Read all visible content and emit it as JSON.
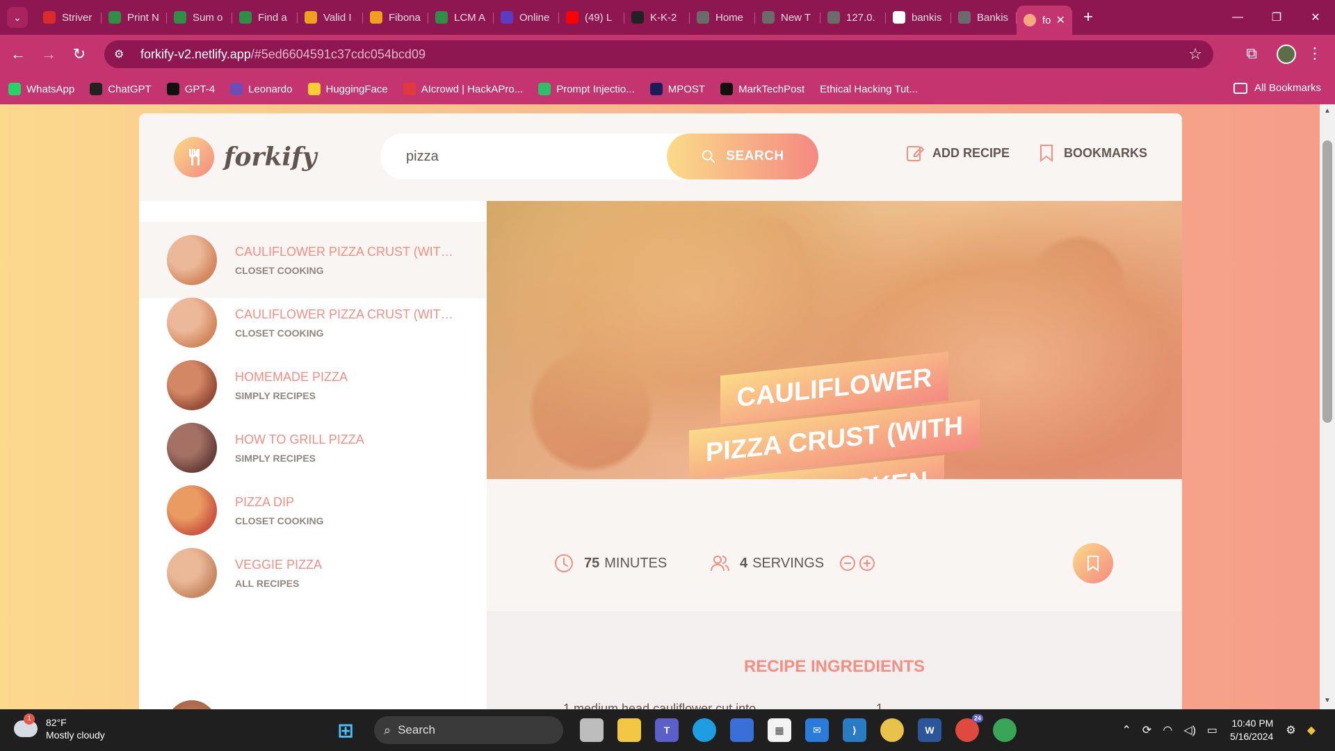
{
  "browser": {
    "tabs": [
      {
        "label": "Striver",
        "color": "#d92b2b",
        "glyph": "TUF"
      },
      {
        "label": "Print N",
        "color": "#2f8d46",
        "glyph": "gg"
      },
      {
        "label": "Sum o",
        "color": "#2f8d46",
        "glyph": "gg"
      },
      {
        "label": "Find a",
        "color": "#2f8d46",
        "glyph": "gg"
      },
      {
        "label": "Valid I",
        "color": "#f0a020",
        "glyph": "L"
      },
      {
        "label": "Fibona",
        "color": "#f0a020",
        "glyph": "L"
      },
      {
        "label": "LCM A",
        "color": "#2f8d46",
        "glyph": "gg"
      },
      {
        "label": "Online",
        "color": "#5b3cc4",
        "glyph": "?"
      },
      {
        "label": "(49) L",
        "color": "#ff0000",
        "glyph": "▶"
      },
      {
        "label": "K-K-2",
        "color": "#222222",
        "glyph": "●"
      },
      {
        "label": "Home",
        "color": "#6b6b6b",
        "glyph": "◎"
      },
      {
        "label": "New T",
        "color": "#6b6b6b",
        "glyph": "◉"
      },
      {
        "label": "127.0.",
        "color": "#6b6b6b",
        "glyph": "◎"
      },
      {
        "label": "bankis",
        "color": "#ffffff",
        "glyph": "G"
      },
      {
        "label": "Bankis",
        "color": "#6b6b6b",
        "glyph": "✲"
      }
    ],
    "active_tab": {
      "label": "fo",
      "color": "#f5a97f"
    },
    "url_host": "forkify-v2.netlify.app",
    "url_path": "/#5ed6604591c37cdc054bcd09",
    "bookmarks": [
      {
        "label": "WhatsApp",
        "color": "#25d366",
        "glyph": "✆"
      },
      {
        "label": "ChatGPT",
        "color": "#222222",
        "glyph": "✺"
      },
      {
        "label": "GPT-4",
        "color": "#111111",
        "glyph": "⚡"
      },
      {
        "label": "Leonardo",
        "color": "#6a4fb6",
        "glyph": "◉"
      },
      {
        "label": "HuggingFace",
        "color": "#ffcc33",
        "glyph": "☺"
      },
      {
        "label": "AIcrowd | HackAPro...",
        "color": "#e03a3a",
        "glyph": "▲"
      },
      {
        "label": "Prompt Injectio...",
        "color": "#2fbf6a",
        "glyph": "●"
      },
      {
        "label": "MPOST",
        "color": "#1c1c5a",
        "glyph": "▪"
      },
      {
        "label": "MarkTechPost",
        "color": "#111111",
        "glyph": "M"
      },
      {
        "label": "Ethical Hacking Tut...",
        "color": "#c4346f",
        "glyph": ""
      }
    ],
    "all_bookmarks": "All Bookmarks"
  },
  "app": {
    "logo_text": "forkify",
    "search_value": "pizza",
    "search_button": "Search",
    "nav": {
      "add_recipe": "Add recipe",
      "bookmarks": "Bookmarks"
    },
    "results": [
      {
        "title": "Cauliflower Pizza Crust (with BBQ Chicken Pizza)",
        "publisher": "Closet Cooking",
        "active": true,
        "thumb": [
          "#e9c9a0",
          "#c98a55"
        ]
      },
      {
        "title": "Cauliflower Pizza Crust (with BBQ Chicken Pizza)",
        "publisher": "Closet Cooking",
        "active": false,
        "thumb": [
          "#e9c9a0",
          "#c98a55"
        ]
      },
      {
        "title": "Homemade Pizza",
        "publisher": "Simply Recipes",
        "active": false,
        "thumb": [
          "#c9875a",
          "#7a3d22"
        ]
      },
      {
        "title": "How to Grill Pizza",
        "publisher": "Simply Recipes",
        "active": false,
        "thumb": [
          "#8a6a5a",
          "#3d2a22"
        ]
      },
      {
        "title": "Pizza Dip",
        "publisher": "Closet Cooking",
        "active": false,
        "thumb": [
          "#e6a257",
          "#c0482d"
        ]
      },
      {
        "title": "Veggie Pizza",
        "publisher": "All Recipes",
        "active": false,
        "thumb": [
          "#e7c89e",
          "#b98a5a"
        ]
      }
    ],
    "recipe": {
      "title": "Cauliflower Pizza Crust (with BBQ Chicken Pizza)",
      "time_value": "75",
      "time_unit": "minutes",
      "servings_value": "4",
      "servings_unit": "servings",
      "ingredients_heading": "Recipe ingredients",
      "ingredients_partial": [
        "1 medium head cauliflower cut into",
        "1"
      ]
    }
  },
  "taskbar": {
    "weather_temp": "82°F",
    "weather_desc": "Mostly cloudy",
    "weather_badge": "1",
    "search_label": "Search",
    "time": "10:40 PM",
    "date": "5/16/2024",
    "chrome_badge": "24"
  }
}
